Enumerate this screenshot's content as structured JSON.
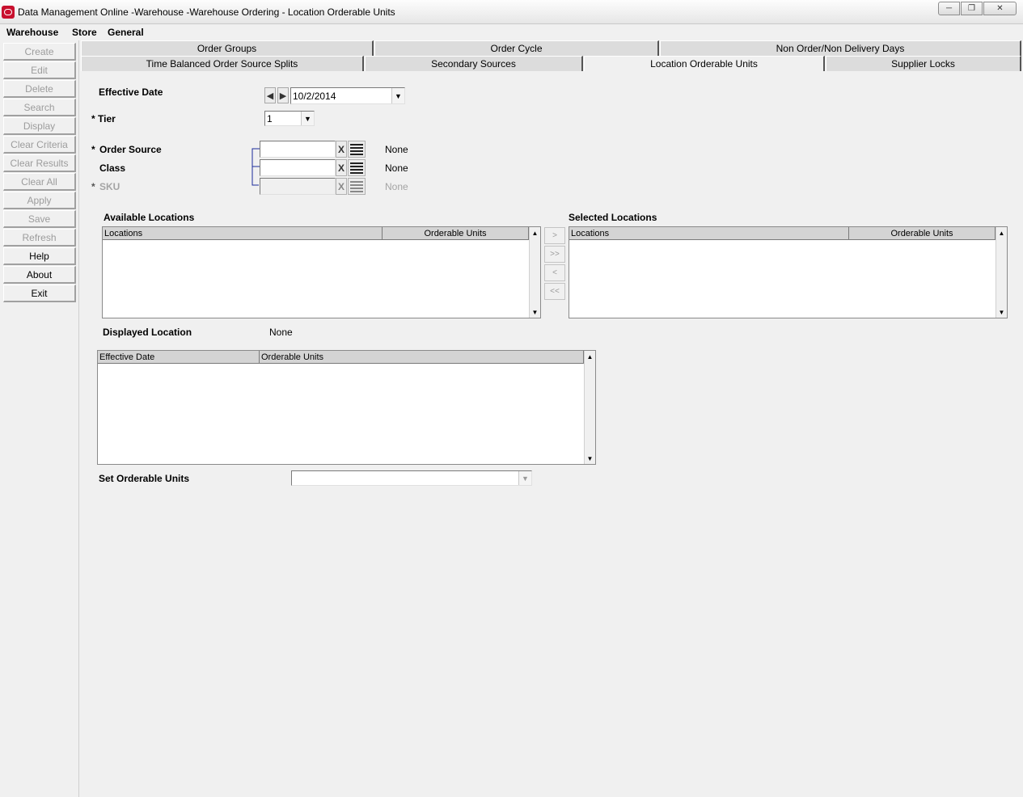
{
  "window": {
    "title": "Data Management Online -Warehouse -Warehouse Ordering - Location Orderable Units",
    "min_icon": "minimize-icon",
    "max_icon": "maximize-icon",
    "close_icon": "close-icon"
  },
  "menu": [
    "Warehouse",
    "Store",
    "General"
  ],
  "sidebar": {
    "buttons": [
      {
        "label": "Create",
        "enabled": false
      },
      {
        "label": "Edit",
        "enabled": false
      },
      {
        "label": "Delete",
        "enabled": false
      },
      {
        "label": "Search",
        "enabled": false
      },
      {
        "label": "Display",
        "enabled": false
      },
      {
        "label": "Clear Criteria",
        "enabled": false
      },
      {
        "label": "Clear Results",
        "enabled": false
      },
      {
        "label": "Clear All",
        "enabled": false
      },
      {
        "label": "Apply",
        "enabled": false
      },
      {
        "label": "Save",
        "enabled": false
      },
      {
        "label": "Refresh",
        "enabled": false
      },
      {
        "label": "Help",
        "enabled": true
      },
      {
        "label": "About",
        "enabled": true
      },
      {
        "label": "Exit",
        "enabled": true
      }
    ]
  },
  "tabs": {
    "row1": [
      "Order Groups",
      "Order Cycle",
      "Non Order/Non Delivery Days"
    ],
    "row2": [
      "Time Balanced Order Source Splits",
      "Secondary Sources",
      "Location Orderable Units",
      "Supplier Locks"
    ],
    "active": "Location Orderable Units"
  },
  "form": {
    "effective_date_label": "Effective Date",
    "effective_date_value": "10/2/2014",
    "tier_label": "* Tier",
    "tier_value": "1",
    "required_marker": "*",
    "order_source_label": "Order Source",
    "order_source_value": "",
    "order_source_desc": "None",
    "class_label": "Class",
    "class_value": "",
    "class_desc": "None",
    "sku_label": "SKU",
    "sku_value": "",
    "sku_desc": "None",
    "clear_glyph": "X"
  },
  "available_locations": {
    "title": "Available Locations",
    "columns": [
      "Locations",
      "Orderable Units"
    ],
    "rows": []
  },
  "selected_locations": {
    "title": "Selected Locations",
    "columns": [
      "Locations",
      "Orderable Units"
    ],
    "rows": []
  },
  "move_buttons": [
    ">",
    ">>",
    "<",
    "<<"
  ],
  "displayed_location": {
    "label": "Displayed Location",
    "value": "None"
  },
  "history_grid": {
    "columns": [
      "Effective Date",
      "Orderable Units"
    ],
    "rows": []
  },
  "set_orderable_units": {
    "label": "Set Orderable Units",
    "value": ""
  }
}
